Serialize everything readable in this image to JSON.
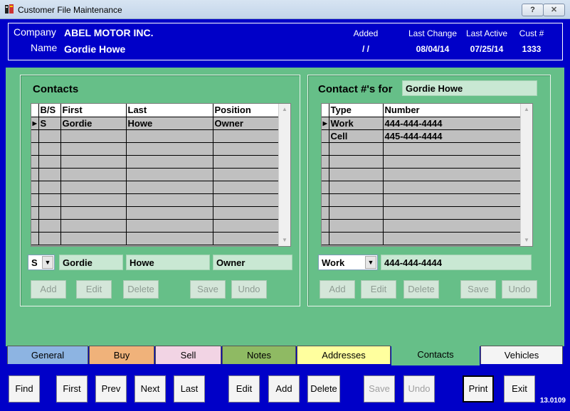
{
  "window": {
    "title": "Customer File Maintenance",
    "help_label": "?",
    "close_label": "✕"
  },
  "header": {
    "company_label": "Company",
    "company_value": "ABEL MOTOR INC.",
    "name_label": "Name",
    "name_value": "Gordie Howe",
    "added_label": "Added",
    "added_value": "/ /",
    "last_change_label": "Last Change",
    "last_change_value": "08/04/14",
    "last_active_label": "Last Active",
    "last_active_value": "07/25/14",
    "cust_label": "Cust #",
    "cust_value": "1333"
  },
  "contacts": {
    "title": "Contacts",
    "columns": [
      "B/S",
      "First",
      "Last",
      "Position"
    ],
    "rows": [
      [
        "S",
        "Gordie",
        "Howe",
        "Owner"
      ]
    ],
    "edit": {
      "bs": "S",
      "first": "Gordie",
      "last": "Howe",
      "position": "Owner"
    },
    "buttons": {
      "add": "Add",
      "edit": "Edit",
      "delete": "Delete",
      "save": "Save",
      "undo": "Undo"
    }
  },
  "numbers": {
    "title": "Contact #'s for",
    "for_name": "Gordie Howe",
    "columns": [
      "Type",
      "Number"
    ],
    "rows": [
      [
        "Work",
        "444-444-4444"
      ],
      [
        "Cell",
        "445-444-4444"
      ]
    ],
    "edit": {
      "type": "Work",
      "number": "444-444-4444"
    },
    "buttons": {
      "add": "Add",
      "edit": "Edit",
      "delete": "Delete",
      "save": "Save",
      "undo": "Undo"
    }
  },
  "tabs": [
    {
      "label": "General",
      "color": "#8db4e2"
    },
    {
      "label": "Buy",
      "color": "#f0b27a"
    },
    {
      "label": "Sell",
      "color": "#f2d4e4"
    },
    {
      "label": "Notes",
      "color": "#8fba63"
    },
    {
      "label": "Addresses",
      "color": "#ffff9e"
    },
    {
      "label": "Contacts",
      "color": "#66bf88"
    },
    {
      "label": "Vehicles",
      "color": "#f4f4f4"
    }
  ],
  "bottom": {
    "find": "Find",
    "first": "First",
    "prev": "Prev",
    "next": "Next",
    "last": "Last",
    "edit": "Edit",
    "add": "Add",
    "delete": "Delete",
    "save": "Save",
    "undo": "Undo",
    "print": "Print",
    "exit": "Exit"
  },
  "version": "13.0109"
}
